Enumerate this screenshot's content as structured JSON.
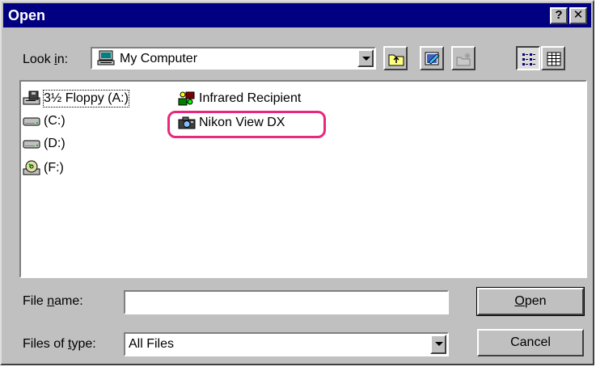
{
  "window": {
    "title": "Open",
    "help_label": "?",
    "close_label": "✕"
  },
  "look_in": {
    "label_prefix": "Look ",
    "label_accel": "i",
    "label_suffix": "n:",
    "value": "My Computer",
    "icon": "computer-icon"
  },
  "toolbar": {
    "buttons": [
      {
        "name": "up-one-level",
        "icon": "folder-up-icon"
      },
      {
        "name": "desktop",
        "icon": "desktop-icon"
      },
      {
        "name": "create-new-folder",
        "icon": "new-folder-icon"
      },
      {
        "name": "list-view",
        "icon": "list-view-icon",
        "pressed": true
      },
      {
        "name": "details-view",
        "icon": "details-view-icon"
      }
    ]
  },
  "files": [
    {
      "label": "3½ Floppy (A:)",
      "icon": "floppy-drive-icon",
      "focused": true
    },
    {
      "label": "(C:)",
      "icon": "hard-drive-icon"
    },
    {
      "label": "(D:)",
      "icon": "hard-drive-icon"
    },
    {
      "label": "(F:)",
      "icon": "cd-drive-icon"
    },
    {
      "label": "Infrared Recipient",
      "icon": "infrared-icon"
    },
    {
      "label": "Nikon View DX",
      "icon": "camera-icon",
      "highlighted": true
    }
  ],
  "file_name": {
    "label_prefix": "File ",
    "label_accel": "n",
    "label_suffix": "ame:",
    "value": ""
  },
  "file_type": {
    "label_prefix": "Files of ",
    "label_accel": "t",
    "label_suffix": "ype:",
    "value": "All Files"
  },
  "buttons": {
    "open_accel": "O",
    "open_rest": "pen",
    "cancel": "Cancel"
  },
  "colors": {
    "titlebar": "#000080",
    "face": "#c0c0c0",
    "highlight_ring": "#e8287c"
  }
}
